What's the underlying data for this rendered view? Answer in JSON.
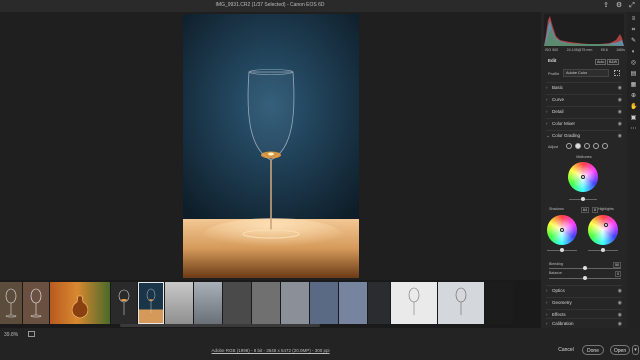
{
  "window": {
    "title": "IMG_9931.CR2  (1/37 Selected)  -  Canon EOS 6D"
  },
  "top_icons": [
    "share-icon",
    "gear-icon",
    "expand-icon"
  ],
  "colors": {
    "panel_bg": "#262626",
    "canvas_bg": "#1f1f1f",
    "accent": "#e8e8e8"
  },
  "panel": {
    "exif": [
      "ISO 500",
      "24-105@75 mm",
      "f/5.6",
      "1/60s"
    ],
    "edit_title": "Edit",
    "auto_label": "Auto",
    "bw_label": "B&W",
    "profile_label": "Profile",
    "profile_value": "Adobe Color",
    "sections_top": [
      {
        "label": "Basic"
      },
      {
        "label": "Curve"
      },
      {
        "label": "Detail"
      },
      {
        "label": "Color Mixer"
      }
    ],
    "color_grading": {
      "label": "Color Grading",
      "adjust_label": "Adjust",
      "midtones_label": "Midtones",
      "shadows_label": "Shadows",
      "highlights_label": "Highlights",
      "blending_label": "Blending",
      "blending_value": "50",
      "balance_label": "Balance",
      "balance_value": "0",
      "hue_value": "64",
      "sat_value": "8"
    },
    "sections_bottom": [
      {
        "label": "Optics"
      },
      {
        "label": "Geometry"
      },
      {
        "label": "Effects"
      },
      {
        "label": "Calibration"
      }
    ]
  },
  "filmstrip": {
    "selected_index": 4
  },
  "bottom": {
    "zoom": "39.8%",
    "file_info": "Adobe RGB (1998) - 8 bit - 3648 x 5472 (20.0MP) - 300 ppi",
    "cancel": "Cancel",
    "done": "Done",
    "open": "Open"
  }
}
